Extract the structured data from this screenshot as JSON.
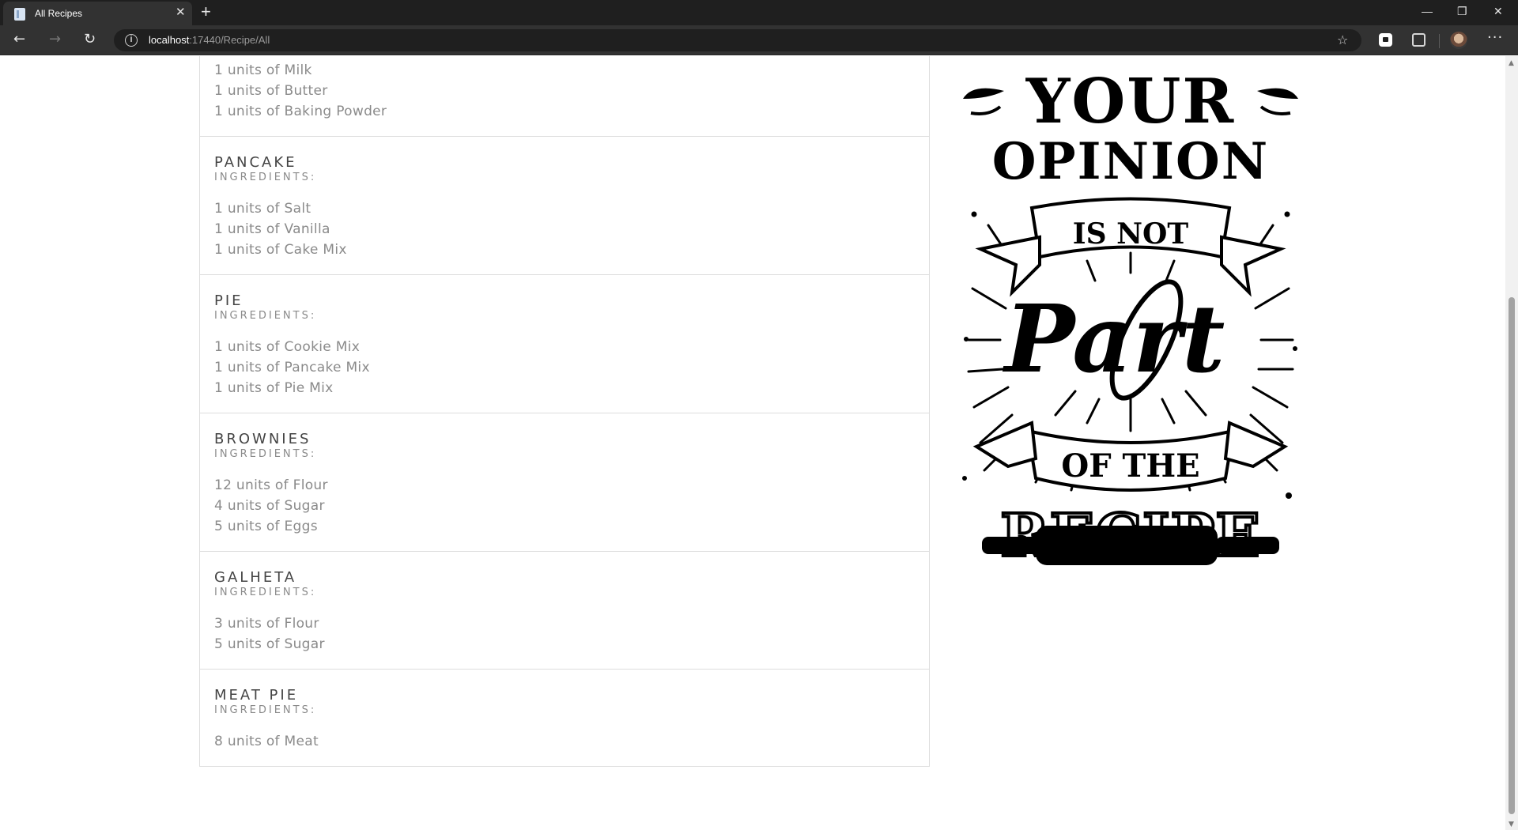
{
  "browser": {
    "tab_title": "All Recipes",
    "tab_close": "✕",
    "new_tab": "+",
    "url_host": "localhost",
    "url_rest": ":17440/Recipe/All",
    "nav": {
      "back": "←",
      "forward": "→",
      "reload": "↻"
    },
    "window": {
      "minimize": "—",
      "restore": "❐",
      "close": "✕"
    },
    "more": "···",
    "info": "i",
    "favorites": "☆"
  },
  "recipes": [
    {
      "name": "",
      "label": "INGREDIENTS:",
      "ingredients": [
        "1 units of Milk",
        "1 units of Butter",
        "1 units of Baking Powder"
      ]
    },
    {
      "name": "PANCAKE",
      "label": "INGREDIENTS:",
      "ingredients": [
        "1 units of Salt",
        "1 units of Vanilla",
        "1 units of Cake Mix"
      ]
    },
    {
      "name": "PIE",
      "label": "INGREDIENTS:",
      "ingredients": [
        "1 units of Cookie Mix",
        "1 units of Pancake Mix",
        "1 units of Pie Mix"
      ]
    },
    {
      "name": "BROWNIES",
      "label": "INGREDIENTS:",
      "ingredients": [
        "12 units of Flour",
        "4 units of Sugar",
        "5 units of Eggs"
      ]
    },
    {
      "name": "GALHETA",
      "label": "INGREDIENTS:",
      "ingredients": [
        "3 units of Flour",
        "5 units of Sugar"
      ]
    },
    {
      "name": "MEAT PIE",
      "label": "INGREDIENTS:",
      "ingredients": [
        "8 units of Meat"
      ]
    }
  ],
  "poster": {
    "line1": "YOUR",
    "line2": "OPINION",
    "line3": "IS NOT",
    "line4": "Part",
    "line5": "OF THE",
    "line6": "RECIPE"
  },
  "colors": {
    "chrome_dark": "#1f1f1f",
    "chrome_toolbar": "#323232",
    "card_border": "#dddddd",
    "text_muted": "#8a8a8a",
    "text_title": "#444444"
  },
  "icons": [
    "page-icon",
    "close-icon",
    "plus-icon",
    "back-arrow-icon",
    "forward-arrow-icon",
    "reload-icon",
    "info-icon",
    "favorites-icon",
    "lock-extension-icon",
    "puzzle-extension-icon",
    "avatar",
    "more-icon",
    "minimize-icon",
    "restore-icon",
    "close-window-icon"
  ]
}
